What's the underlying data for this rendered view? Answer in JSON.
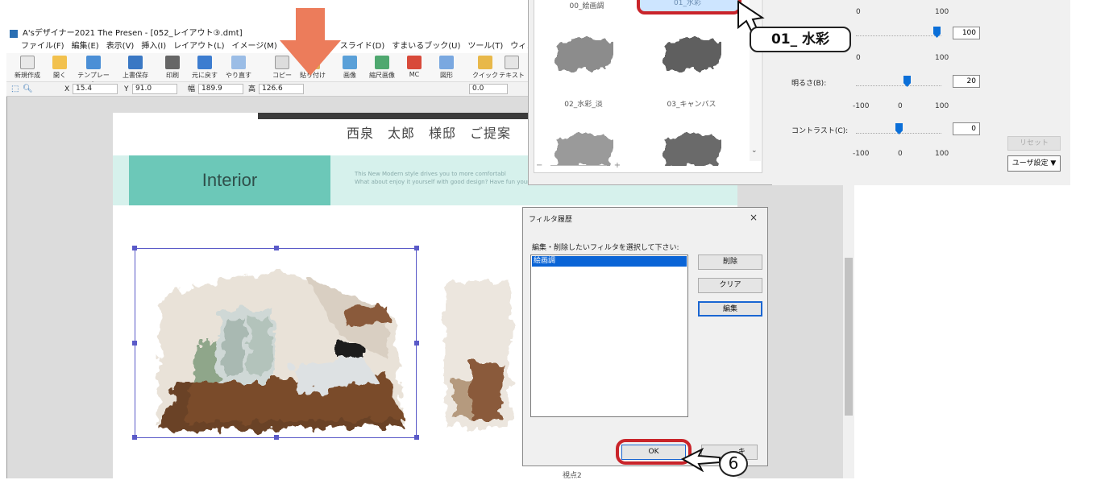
{
  "window": {
    "title": "A'sデザイナー2021 The Presen - [052_レイアウト③.dmt]"
  },
  "menu": {
    "left": [
      "ファイル(F)",
      "編集(E)",
      "表示(V)",
      "挿入(I)",
      "レイアウト(L)",
      "イメージ(M)"
    ],
    "right": [
      "スライド(D)",
      "すまいるブック(U)",
      "ツール(T)",
      "ウィンドウ(W)"
    ]
  },
  "toolbar": {
    "new": "新規作成",
    "open": "開く",
    "template": "テンプレート",
    "save": "上書保存",
    "print": "印刷",
    "undo": "元に戻す",
    "redo": "やり直す",
    "copy": "コピー",
    "paste": "貼り付け",
    "image": "画像",
    "scale_image": "縮尺画像",
    "mc": "MC",
    "shape": "図形",
    "quick": "クイック",
    "text": "テキスト"
  },
  "coords": {
    "x_label": "X",
    "x_value": "15.4",
    "y_label": "Y",
    "y_value": "91.0",
    "w_label": "幅",
    "w_value": "189.9",
    "h_label": "高",
    "h_value": "126.6",
    "rot_value": "0.0"
  },
  "page": {
    "title": "西泉　太郎　様邸　ご提案",
    "section": "Interior",
    "band_text_1": "This New Modern style drives you to more comfortabl",
    "band_text_2": "What about enjoy it yourself with good design? Have fun your way."
  },
  "filters": {
    "selected_label_top": "00_絵画調",
    "selected_label": "01_水彩",
    "items": [
      {
        "label": "02_水彩_淡"
      },
      {
        "label": "03_キャンバス"
      }
    ],
    "zoom_minus": "−",
    "zoom_plus": "+"
  },
  "settings": {
    "scale_a": [
      "0",
      "100"
    ],
    "value_top": "100",
    "scale_b": [
      "0",
      "100"
    ],
    "brightness_label": "明るさ(B):",
    "brightness_value": "20",
    "brightness_scale": [
      "-100",
      "0",
      "100"
    ],
    "contrast_label": "コントラスト(C):",
    "contrast_value": "0",
    "contrast_scale": [
      "-100",
      "0",
      "100"
    ],
    "reset": "リセット",
    "user": "ユーザ設定 ▼"
  },
  "callout": {
    "text": "01_ 水彩"
  },
  "dialog": {
    "title": "フィルタ履歴",
    "close": "×",
    "prompt": "編集・削除したいフィルタを選択して下さい:",
    "item": "絵画調",
    "delete": "削除",
    "clear": "クリア",
    "edit": "編集",
    "ok": "OK",
    "cancel_partial": "キ",
    "viewpoint": "視点2"
  },
  "step": "6"
}
